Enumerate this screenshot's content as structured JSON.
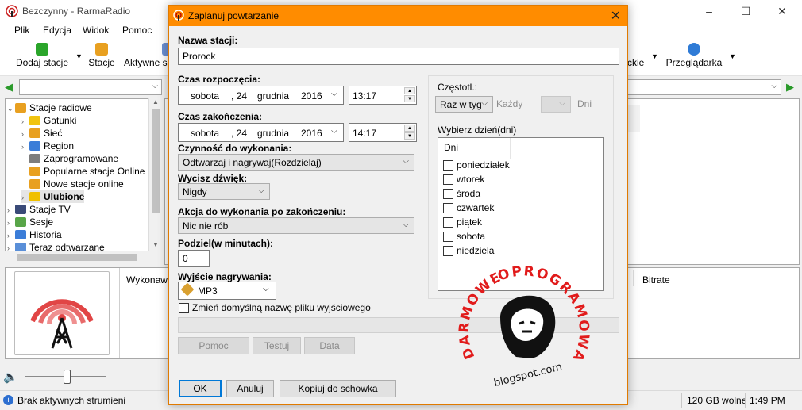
{
  "app": {
    "title": "Bezczynny - RarmaRadio",
    "menu": [
      "Plik",
      "Edycja",
      "Widok",
      "Pomoc"
    ],
    "toolbar": {
      "add_stations": "Dodaj stacje",
      "stations": "Stacje",
      "active": "Aktywne s",
      "right_cut": "ckie",
      "browser": "Przeglądarka"
    },
    "tree": [
      {
        "label": "Stacje radiowe",
        "level": 0,
        "expander": "open",
        "icon": "radio-folder-icon"
      },
      {
        "label": "Gatunki",
        "level": 1,
        "expander": "closed",
        "icon": "folder-icon"
      },
      {
        "label": "Sieć",
        "level": 1,
        "expander": "closed",
        "icon": "radio-folder-icon"
      },
      {
        "label": "Region",
        "level": 1,
        "expander": "closed",
        "icon": "globe-icon"
      },
      {
        "label": "Zaprogramowane",
        "level": 1,
        "expander": "",
        "icon": "clock-icon"
      },
      {
        "label": "Popularne stacje Online",
        "level": 1,
        "expander": "",
        "icon": "radio-folder-icon"
      },
      {
        "label": "Nowe stacje online",
        "level": 1,
        "expander": "",
        "icon": "radio-folder-icon"
      },
      {
        "label": "Ulubione",
        "level": 1,
        "expander": "closed",
        "icon": "star-icon"
      },
      {
        "label": "Stacje TV",
        "level": 0,
        "expander": "closed",
        "icon": "tv-icon"
      },
      {
        "label": "Sesje",
        "level": 0,
        "expander": "closed",
        "icon": "sessions-icon"
      },
      {
        "label": "Historia",
        "level": 0,
        "expander": "closed",
        "icon": "history-icon"
      },
      {
        "label": "Teraz odtwarzane",
        "level": 0,
        "expander": "closed",
        "icon": "playing-icon"
      }
    ],
    "bottom": {
      "performer_col": "Wykonawc",
      "bitrate_col": "Bitrate"
    },
    "status": {
      "text": "Brak aktywnych strumieni",
      "disk": "120 GB wolne",
      "time": "1:49 PM"
    },
    "colors": {
      "accent": "#ff8c00"
    }
  },
  "dialog": {
    "title": "Zaplanuj powtarzanie",
    "station_label": "Nazwa stacji:",
    "station_value": "Prorock",
    "start_label": "Czas rozpoczęcia:",
    "start_date": {
      "day": "sobota",
      "num": ", 24",
      "month": "grudnia",
      "year": "2016"
    },
    "start_time": "13:17",
    "end_label": "Czas zakończenia:",
    "end_date": {
      "day": "sobota",
      "num": ", 24",
      "month": "grudnia",
      "year": "2016"
    },
    "end_time": "14:17",
    "action_label": "Czynność do wykonania:",
    "action_value": "Odtwarzaj i nagrywaj(Rozdzielaj)",
    "mute_label": "Wycisz dźwięk:",
    "mute_value": "Nigdy",
    "after_label": "Akcja do wykonania po zakończeniu:",
    "after_value": "Nic nie rób",
    "split_label": "Podziel(w minutach):",
    "split_value": "0",
    "output_label": "Wyjście nagrywania:",
    "output_value": "MP3",
    "rename_label": "Zmień domyślną nazwę pliku wyjściowego",
    "freq_label": "Częstotl.:",
    "freq_value": "Raz w tyg",
    "every_label": "Każdy",
    "days_unit": "Dni",
    "pick_days_label": "Wybierz dzień(dni)",
    "days_header": "Dni",
    "days": [
      "poniedziałek",
      "wtorek",
      "środa",
      "czwartek",
      "piątek",
      "sobota",
      "niedziela"
    ],
    "buttons": {
      "help": "Pomoc",
      "test": "Testuj",
      "date": "Data",
      "ok": "OK",
      "cancel": "Anuluj",
      "copy": "Kopiuj do schowka"
    }
  },
  "watermark": {
    "left": "DARMOWE",
    "top": "OPROGRAMOWANIE",
    "bottom": "blogspot.com"
  }
}
